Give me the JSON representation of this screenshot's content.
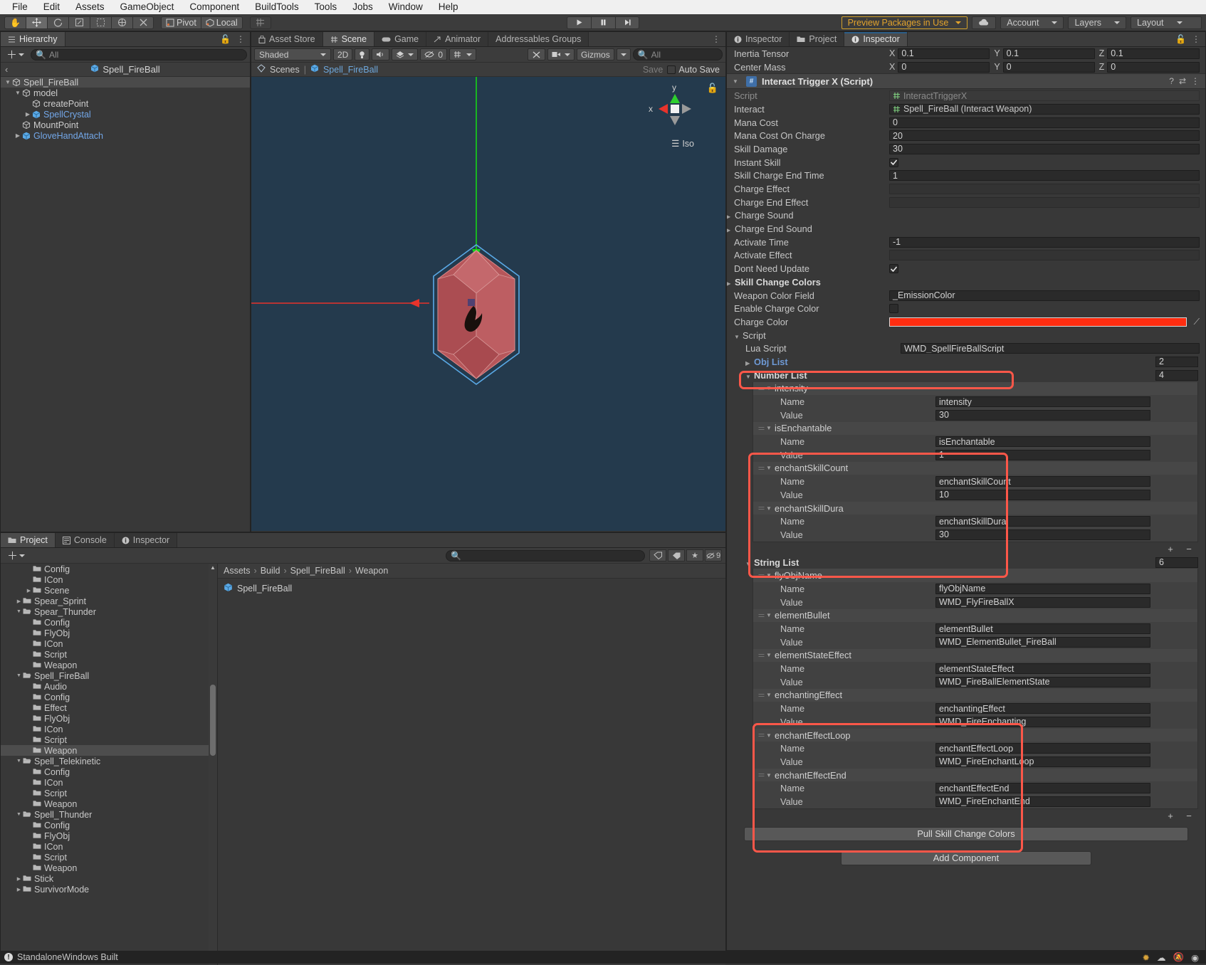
{
  "menubar": [
    "File",
    "Edit",
    "Assets",
    "GameObject",
    "Component",
    "BuildTools",
    "Tools",
    "Jobs",
    "Window",
    "Help"
  ],
  "toolbar": {
    "pivot_label": "Pivot",
    "local_label": "Local",
    "preview_packages": "Preview Packages in Use",
    "account": "Account",
    "layers": "Layers",
    "layout": "Layout"
  },
  "hierarchy": {
    "tab": "Hierarchy",
    "search_placeholder": "All",
    "breadcrumb": "Spell_FireBall",
    "items": [
      {
        "label": "Spell_FireBall",
        "depth": 1,
        "arrow": "down",
        "prefab": false,
        "selected": true
      },
      {
        "label": "model",
        "depth": 2,
        "arrow": "down",
        "prefab": false,
        "selected": false
      },
      {
        "label": "createPoint",
        "depth": 3,
        "arrow": "none",
        "prefab": false,
        "selected": false
      },
      {
        "label": "SpellCrystal",
        "depth": 3,
        "arrow": "right",
        "prefab": true,
        "selected": false
      },
      {
        "label": "MountPoint",
        "depth": 2,
        "arrow": "none",
        "prefab": false,
        "selected": false
      },
      {
        "label": "GloveHandAttach",
        "depth": 2,
        "arrow": "right",
        "prefab": true,
        "selected": false
      }
    ]
  },
  "scene": {
    "tabs": [
      "Asset Store",
      "Scene",
      "Game",
      "Animator",
      "Addressables Groups"
    ],
    "active_tab": "Scene",
    "shading": "Shaded",
    "mode_2d": "2D",
    "effects_count": "0",
    "gizmos": "Gizmos",
    "search_placeholder": "All",
    "breadcrumb_scenes": "Scenes",
    "breadcrumb_object": "Spell_FireBall",
    "save_label": "Save",
    "autosave_label": "Auto Save",
    "axis_x": "x",
    "axis_y": "y",
    "view_mode": "Iso"
  },
  "project": {
    "tabs": [
      "Project",
      "Console",
      "Inspector"
    ],
    "active_tab": "Project",
    "search_placeholder": "",
    "hidden_count": "9",
    "breadcrumb": [
      "Assets",
      "Build",
      "Spell_FireBall",
      "Weapon"
    ],
    "asset_name": "Spell_FireBall",
    "tree": [
      {
        "label": "Config",
        "depth": 3,
        "arrow": "none",
        "selected": false,
        "open": false
      },
      {
        "label": "ICon",
        "depth": 3,
        "arrow": "none",
        "selected": false,
        "open": false
      },
      {
        "label": "Scene",
        "depth": 3,
        "arrow": "right",
        "selected": false,
        "open": false
      },
      {
        "label": "Spear_Sprint",
        "depth": 2,
        "arrow": "right",
        "selected": false,
        "open": false
      },
      {
        "label": "Spear_Thunder",
        "depth": 2,
        "arrow": "down",
        "selected": false,
        "open": true
      },
      {
        "label": "Config",
        "depth": 3,
        "arrow": "none",
        "selected": false,
        "open": false
      },
      {
        "label": "FlyObj",
        "depth": 3,
        "arrow": "none",
        "selected": false,
        "open": false
      },
      {
        "label": "ICon",
        "depth": 3,
        "arrow": "none",
        "selected": false,
        "open": false
      },
      {
        "label": "Script",
        "depth": 3,
        "arrow": "none",
        "selected": false,
        "open": false
      },
      {
        "label": "Weapon",
        "depth": 3,
        "arrow": "none",
        "selected": false,
        "open": false
      },
      {
        "label": "Spell_FireBall",
        "depth": 2,
        "arrow": "down",
        "selected": false,
        "open": true
      },
      {
        "label": "Audio",
        "depth": 3,
        "arrow": "none",
        "selected": false,
        "open": false
      },
      {
        "label": "Config",
        "depth": 3,
        "arrow": "none",
        "selected": false,
        "open": false
      },
      {
        "label": "Effect",
        "depth": 3,
        "arrow": "none",
        "selected": false,
        "open": false
      },
      {
        "label": "FlyObj",
        "depth": 3,
        "arrow": "none",
        "selected": false,
        "open": false
      },
      {
        "label": "ICon",
        "depth": 3,
        "arrow": "none",
        "selected": false,
        "open": false
      },
      {
        "label": "Script",
        "depth": 3,
        "arrow": "none",
        "selected": false,
        "open": false
      },
      {
        "label": "Weapon",
        "depth": 3,
        "arrow": "none",
        "selected": true,
        "open": false
      },
      {
        "label": "Spell_Telekinetic",
        "depth": 2,
        "arrow": "down",
        "selected": false,
        "open": true
      },
      {
        "label": "Config",
        "depth": 3,
        "arrow": "none",
        "selected": false,
        "open": false
      },
      {
        "label": "ICon",
        "depth": 3,
        "arrow": "none",
        "selected": false,
        "open": false
      },
      {
        "label": "Script",
        "depth": 3,
        "arrow": "none",
        "selected": false,
        "open": false
      },
      {
        "label": "Weapon",
        "depth": 3,
        "arrow": "none",
        "selected": false,
        "open": false
      },
      {
        "label": "Spell_Thunder",
        "depth": 2,
        "arrow": "down",
        "selected": false,
        "open": true
      },
      {
        "label": "Config",
        "depth": 3,
        "arrow": "none",
        "selected": false,
        "open": false
      },
      {
        "label": "FlyObj",
        "depth": 3,
        "arrow": "none",
        "selected": false,
        "open": false
      },
      {
        "label": "ICon",
        "depth": 3,
        "arrow": "none",
        "selected": false,
        "open": false
      },
      {
        "label": "Script",
        "depth": 3,
        "arrow": "none",
        "selected": false,
        "open": false
      },
      {
        "label": "Weapon",
        "depth": 3,
        "arrow": "none",
        "selected": false,
        "open": false
      },
      {
        "label": "Stick",
        "depth": 2,
        "arrow": "right",
        "selected": false,
        "open": false
      },
      {
        "label": "SurvivorMode",
        "depth": 2,
        "arrow": "right",
        "selected": false,
        "open": false
      }
    ]
  },
  "inspector": {
    "tabs": [
      "Inspector",
      "Project",
      "Inspector"
    ],
    "active_tab_index": 2,
    "rigidbody_rows": [
      {
        "label": "Inertia Tensor",
        "x": "0.1",
        "y": "0.1",
        "z": "0.1"
      },
      {
        "label": "Center Mass",
        "x": "0",
        "y": "0",
        "z": "0"
      }
    ],
    "component_title": "Interact Trigger X (Script)",
    "fields": [
      {
        "label": "Script",
        "value": "InteractTriggerX",
        "type": "objref-disabled"
      },
      {
        "label": "Interact",
        "value": "Spell_FireBall (Interact Weapon)",
        "type": "objref"
      },
      {
        "label": "Mana Cost",
        "value": "0",
        "type": "text"
      },
      {
        "label": "Mana Cost On Charge",
        "value": "20",
        "type": "text"
      },
      {
        "label": "Skill Damage",
        "value": "30",
        "type": "text"
      },
      {
        "label": "Instant Skill",
        "value": "",
        "type": "checkbox-on"
      },
      {
        "label": "Skill Charge End Time",
        "value": "1",
        "type": "text"
      },
      {
        "label": "Charge Effect",
        "value": "",
        "type": "empty"
      },
      {
        "label": "Charge End Effect",
        "value": "",
        "type": "empty"
      },
      {
        "label": "Charge Sound",
        "value": "",
        "type": "foldout"
      },
      {
        "label": "Charge End Sound",
        "value": "",
        "type": "foldout"
      },
      {
        "label": "Activate Time",
        "value": "-1",
        "type": "text"
      },
      {
        "label": "Activate Effect",
        "value": "",
        "type": "empty"
      },
      {
        "label": "Dont Need Update",
        "value": "",
        "type": "checkbox-on"
      },
      {
        "label": "Skill Change Colors",
        "value": "",
        "type": "foldout-bold"
      },
      {
        "label": "Weapon Color Field",
        "value": "_EmissionColor",
        "type": "text"
      },
      {
        "label": "Enable Charge Color",
        "value": "",
        "type": "checkbox-off"
      },
      {
        "label": "Charge Color",
        "value": "",
        "type": "color"
      }
    ],
    "charge_color_hex": "#ff2d10",
    "script_section_label": "Script",
    "lua_script_label": "Lua Script",
    "lua_script_value": "WMD_SpellFireBallScript",
    "obj_list_label": "Obj List",
    "obj_list_count": "2",
    "number_list_label": "Number List",
    "number_list_count": "4",
    "number_list": [
      {
        "key": "intensity",
        "name_label": "Name",
        "name": "intensity",
        "value_label": "Value",
        "value": "30"
      },
      {
        "key": "isEnchantable",
        "name_label": "Name",
        "name": "isEnchantable",
        "value_label": "Value",
        "value": "1"
      },
      {
        "key": "enchantSkillCount",
        "name_label": "Name",
        "name": "enchantSkillCount",
        "value_label": "Value",
        "value": "10"
      },
      {
        "key": "enchantSkillDura",
        "name_label": "Name",
        "name": "enchantSkillDura",
        "value_label": "Value",
        "value": "30"
      }
    ],
    "string_list_label": "String List",
    "string_list_count": "6",
    "string_list": [
      {
        "key": "flyObjName",
        "name_label": "Name",
        "name": "flyObjName",
        "value_label": "Value",
        "value": "WMD_FlyFireBallX"
      },
      {
        "key": "elementBullet",
        "name_label": "Name",
        "name": "elementBullet",
        "value_label": "Value",
        "value": "WMD_ElementBullet_FireBall"
      },
      {
        "key": "elementStateEffect",
        "name_label": "Name",
        "name": "elementStateEffect",
        "value_label": "Value",
        "value": "WMD_FireBallElementState"
      },
      {
        "key": "enchantingEffect",
        "name_label": "Name",
        "name": "enchantingEffect",
        "value_label": "Value",
        "value": "WMD_FireEnchanting"
      },
      {
        "key": "enchantEffectLoop",
        "name_label": "Name",
        "name": "enchantEffectLoop",
        "value_label": "Value",
        "value": "WMD_FireEnchantLoop"
      },
      {
        "key": "enchantEffectEnd",
        "name_label": "Name",
        "name": "enchantEffectEnd",
        "value_label": "Value",
        "value": "WMD_FireEnchantEnd"
      }
    ],
    "add_list_plus": "+",
    "add_list_minus": "−",
    "pull_skill_button": "Pull Skill Change Colors",
    "add_component_button": "Add Component",
    "highlight_color": "#fc5749"
  },
  "statusbar": {
    "message": "StandaloneWindows Built"
  }
}
